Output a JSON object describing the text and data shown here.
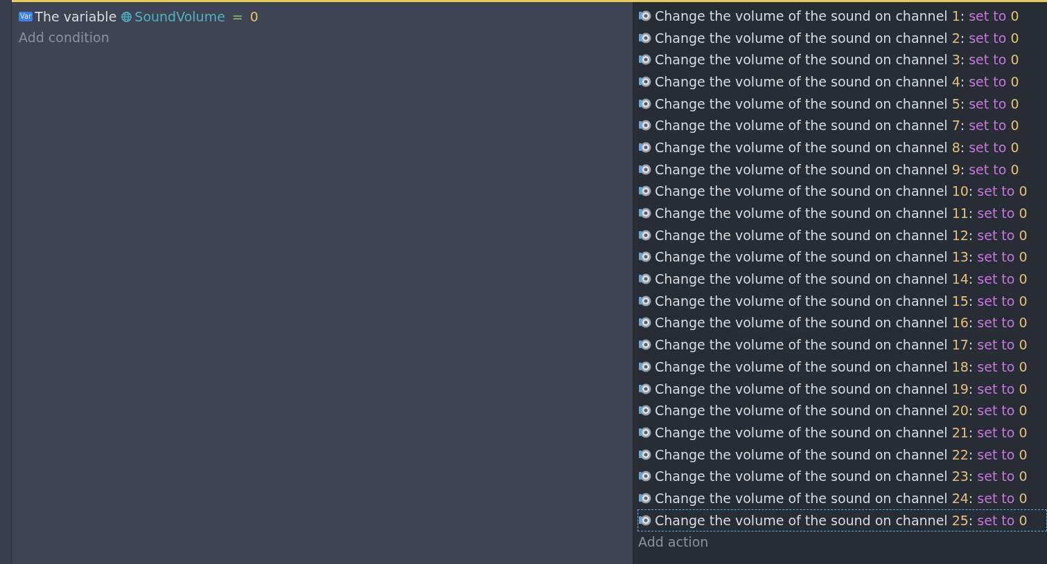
{
  "condition": {
    "badge": "Var",
    "prefix": "The variable",
    "variable": "SoundVolume",
    "operator": "=",
    "value": "0"
  },
  "add_condition": "Add condition",
  "actions": [
    {
      "text": "Change the volume of the sound on channel",
      "channel": "1",
      "colon": ":",
      "operation": "set to",
      "value": "0",
      "selected": false
    },
    {
      "text": "Change the volume of the sound on channel",
      "channel": "2",
      "colon": ":",
      "operation": "set to",
      "value": "0",
      "selected": false
    },
    {
      "text": "Change the volume of the sound on channel",
      "channel": "3",
      "colon": ":",
      "operation": "set to",
      "value": "0",
      "selected": false
    },
    {
      "text": "Change the volume of the sound on channel",
      "channel": "4",
      "colon": ":",
      "operation": "set to",
      "value": "0",
      "selected": false
    },
    {
      "text": "Change the volume of the sound on channel",
      "channel": "5",
      "colon": ":",
      "operation": "set to",
      "value": "0",
      "selected": false
    },
    {
      "text": "Change the volume of the sound on channel",
      "channel": "7",
      "colon": ":",
      "operation": "set to",
      "value": "0",
      "selected": false
    },
    {
      "text": "Change the volume of the sound on channel",
      "channel": "8",
      "colon": ":",
      "operation": "set to",
      "value": "0",
      "selected": false
    },
    {
      "text": "Change the volume of the sound on channel",
      "channel": "9",
      "colon": ":",
      "operation": "set to",
      "value": "0",
      "selected": false
    },
    {
      "text": "Change the volume of the sound on channel",
      "channel": "10",
      "colon": ":",
      "operation": "set to",
      "value": "0",
      "selected": false
    },
    {
      "text": "Change the volume of the sound on channel",
      "channel": "11",
      "colon": ":",
      "operation": "set to",
      "value": "0",
      "selected": false
    },
    {
      "text": "Change the volume of the sound on channel",
      "channel": "12",
      "colon": ":",
      "operation": "set to",
      "value": "0",
      "selected": false
    },
    {
      "text": "Change the volume of the sound on channel",
      "channel": "13",
      "colon": ":",
      "operation": "set to",
      "value": "0",
      "selected": false
    },
    {
      "text": "Change the volume of the sound on channel",
      "channel": "14",
      "colon": ":",
      "operation": "set to",
      "value": "0",
      "selected": false
    },
    {
      "text": "Change the volume of the sound on channel",
      "channel": "15",
      "colon": ":",
      "operation": "set to",
      "value": "0",
      "selected": false
    },
    {
      "text": "Change the volume of the sound on channel",
      "channel": "16",
      "colon": ":",
      "operation": "set to",
      "value": "0",
      "selected": false
    },
    {
      "text": "Change the volume of the sound on channel",
      "channel": "17",
      "colon": ":",
      "operation": "set to",
      "value": "0",
      "selected": false
    },
    {
      "text": "Change the volume of the sound on channel",
      "channel": "18",
      "colon": ":",
      "operation": "set to",
      "value": "0",
      "selected": false
    },
    {
      "text": "Change the volume of the sound on channel",
      "channel": "19",
      "colon": ":",
      "operation": "set to",
      "value": "0",
      "selected": false
    },
    {
      "text": "Change the volume of the sound on channel",
      "channel": "20",
      "colon": ":",
      "operation": "set to",
      "value": "0",
      "selected": false
    },
    {
      "text": "Change the volume of the sound on channel",
      "channel": "21",
      "colon": ":",
      "operation": "set to",
      "value": "0",
      "selected": false
    },
    {
      "text": "Change the volume of the sound on channel",
      "channel": "22",
      "colon": ":",
      "operation": "set to",
      "value": "0",
      "selected": false
    },
    {
      "text": "Change the volume of the sound on channel",
      "channel": "23",
      "colon": ":",
      "operation": "set to",
      "value": "0",
      "selected": false
    },
    {
      "text": "Change the volume of the sound on channel",
      "channel": "24",
      "colon": ":",
      "operation": "set to",
      "value": "0",
      "selected": false
    },
    {
      "text": "Change the volume of the sound on channel",
      "channel": "25",
      "colon": ":",
      "operation": "set to",
      "value": "0",
      "selected": true
    }
  ],
  "add_action": "Add action"
}
